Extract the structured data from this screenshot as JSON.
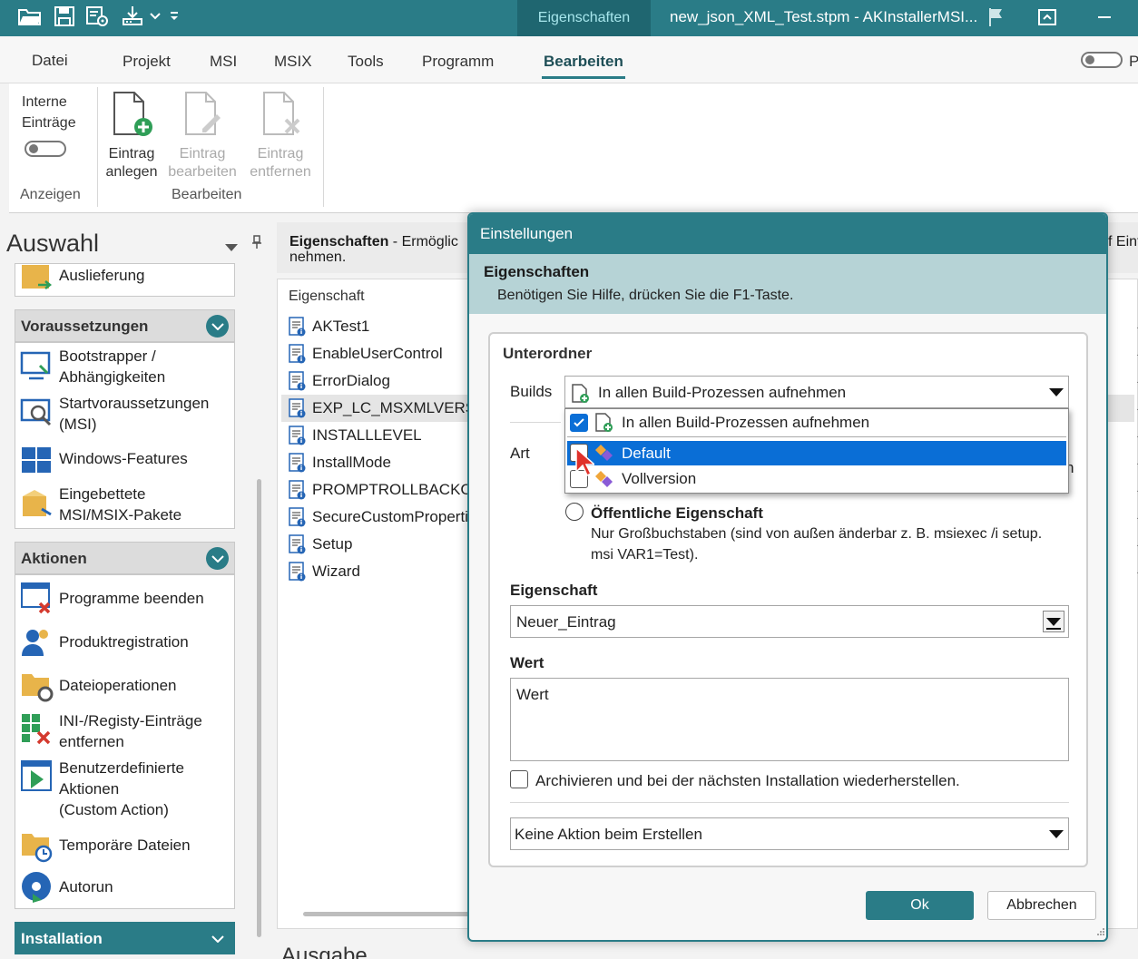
{
  "titlebar": {
    "active_tab": "Eigenschaften",
    "window_title": "new_json_XML_Test.stpm - AKInstallerMSI..."
  },
  "menu": {
    "items": [
      "Datei",
      "Projekt",
      "MSI",
      "MSIX",
      "Tools",
      "Programm",
      "Bearbeiten"
    ],
    "active": "Bearbeiten",
    "right_letter": "P"
  },
  "ribbon": {
    "interne_line1": "Interne",
    "interne_line2": "Einträge",
    "anzeigen_group": "Anzeigen",
    "eintrag_anlegen_line1": "Eintrag",
    "eintrag_anlegen_line2": "anlegen",
    "eintrag_bearbeiten_line1": "Eintrag",
    "eintrag_bearbeiten_line2": "bearbeiten",
    "eintrag_entfernen_line1": "Eintrag",
    "eintrag_entfernen_line2": "entfernen",
    "bearbeiten_group": "Bearbeiten"
  },
  "sidebar": {
    "title": "Auswahl",
    "auslieferung": "Auslieferung",
    "section_voraussetzungen": "Voraussetzungen",
    "voraussetzungen_items": [
      "Bootstrapper /\nAbhängigkeiten",
      "Startvoraussetzungen\n(MSI)",
      "Windows-Features",
      "Eingebettete\nMSI/MSIX-Pakete"
    ],
    "section_aktionen": "Aktionen",
    "aktionen_items": [
      "Programme beenden",
      "Produktregistration",
      "Dateioperationen",
      "INI-/Registy-Einträge\nentfernen",
      "Benutzerdefinierte\nAktionen\n(Custom Action)",
      "Temporäre Dateien",
      "Autorun"
    ],
    "section_installation": "Installation"
  },
  "main": {
    "header_bold": "Eigenschaften",
    "header_rest": " - Ermöglic",
    "header_line2": "nehmen.",
    "header_right": "f Einf",
    "column_header": "Eigenschaft",
    "rows": [
      "AKTest1",
      "EnableUserControl",
      "ErrorDialog",
      "EXP_LC_MSXMLVERSIO",
      "INSTALLLEVEL",
      "InstallMode",
      "PROMPTROLLBACKCO",
      "SecureCustomPropertie",
      "Setup",
      "Wizard"
    ],
    "selected_row": "EXP_LC_MSXMLVERSIO",
    "ausgabe": "Ausgabe"
  },
  "dialog": {
    "title": "Einstellungen",
    "help_title": "Eigenschaften",
    "help_text": "Benötigen Sie Hilfe, drücken Sie die F1-Taste.",
    "unterordner": "Unterordner",
    "builds_label": "Builds",
    "builds_value": "In allen Build-Prozessen aufnehmen",
    "builds_options": [
      "In allen Build-Prozessen aufnehmen",
      "Default",
      "Vollversion"
    ],
    "builds_highlighted": "Default",
    "art_label": "Art",
    "art_partial_right": "n",
    "public_property_title": "Öffentliche Eigenschaft",
    "public_property_desc1": "Nur Großbuchstaben (sind von außen änderbar z. B. msiexec /i setup.",
    "public_property_desc2": "msi VAR1=Test).",
    "eigenschaft_label": "Eigenschaft",
    "eigenschaft_value": "Neuer_Eintrag",
    "wert_label": "Wert",
    "wert_value": "Wert",
    "archive_label": "Archivieren und bei der nächsten Installation wiederherstellen.",
    "action_value": "Keine Aktion beim Erstellen",
    "ok": "Ok",
    "cancel": "Abbrechen"
  },
  "colors": {
    "accent": "#2a7c87",
    "accent_dark": "#1f6670",
    "help_band": "#b6d3d6",
    "highlight": "#0a6ed6"
  }
}
